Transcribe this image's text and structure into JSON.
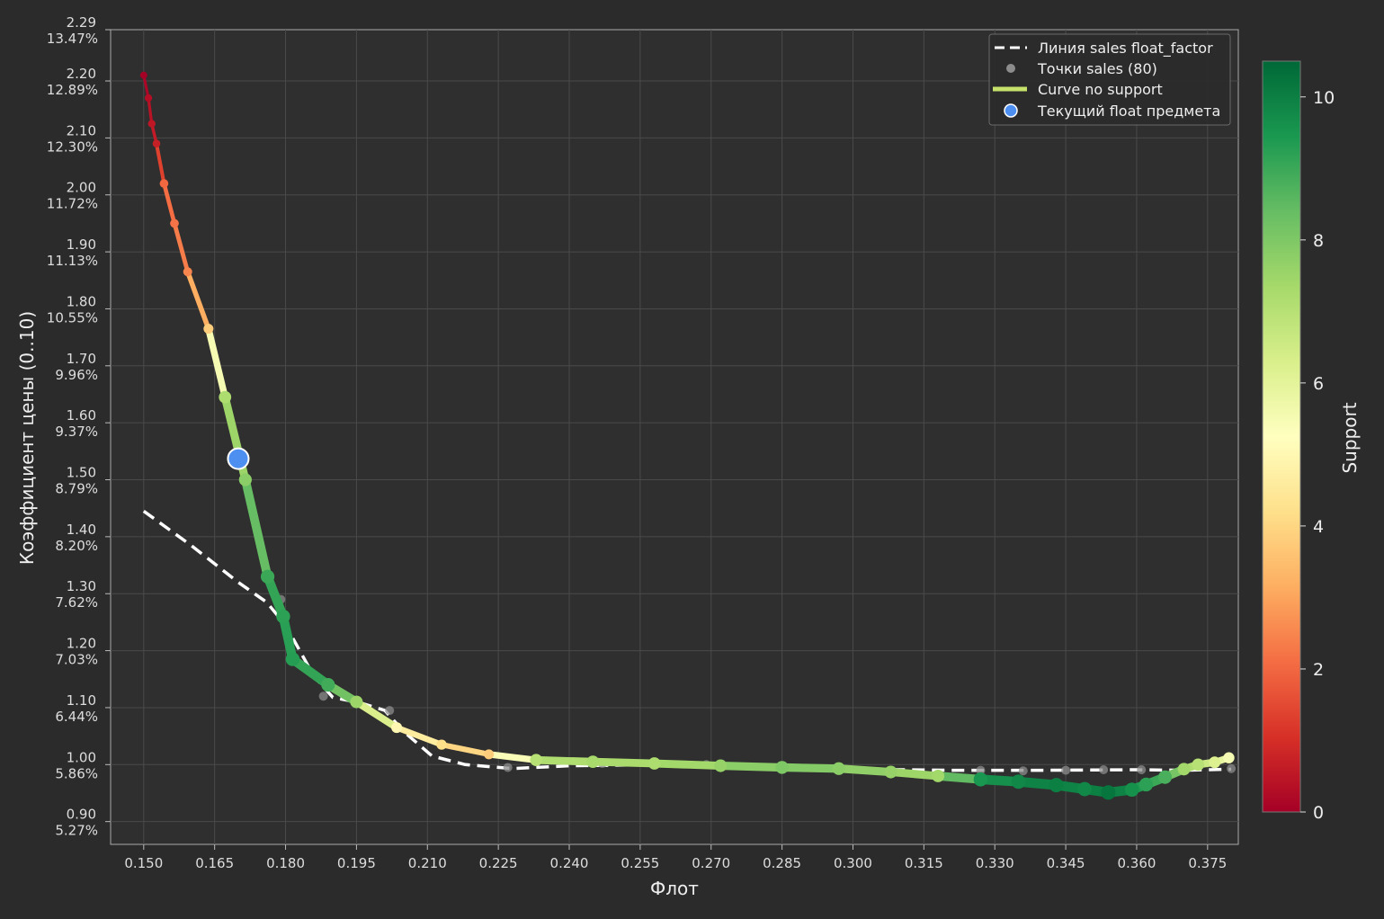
{
  "chart_data": {
    "type": "line",
    "xlabel": "Флот",
    "ylabel": "Коэффициент цены (0..10)",
    "xlim": [
      0.143,
      0.3815
    ],
    "ylim": [
      0.86,
      2.29
    ],
    "x_ticks": [
      "0.150",
      "0.165",
      "0.180",
      "0.195",
      "0.210",
      "0.225",
      "0.240",
      "0.255",
      "0.270",
      "0.285",
      "0.300",
      "0.315",
      "0.330",
      "0.345",
      "0.360",
      "0.375"
    ],
    "y_ticks": [
      {
        "value": 2.29,
        "label": "2.29",
        "pct": "13.47%"
      },
      {
        "value": 2.2,
        "label": "2.20",
        "pct": "12.89%"
      },
      {
        "value": 2.1,
        "label": "2.10",
        "pct": "12.30%"
      },
      {
        "value": 2.0,
        "label": "2.00",
        "pct": "11.72%"
      },
      {
        "value": 1.9,
        "label": "1.90",
        "pct": "11.13%"
      },
      {
        "value": 1.8,
        "label": "1.80",
        "pct": "10.55%"
      },
      {
        "value": 1.7,
        "label": "1.70",
        "pct": "9.96%"
      },
      {
        "value": 1.6,
        "label": "1.60",
        "pct": "9.37%"
      },
      {
        "value": 1.5,
        "label": "1.50",
        "pct": "8.79%"
      },
      {
        "value": 1.4,
        "label": "1.40",
        "pct": "8.20%"
      },
      {
        "value": 1.3,
        "label": "1.30",
        "pct": "7.62%"
      },
      {
        "value": 1.2,
        "label": "1.20",
        "pct": "7.03%"
      },
      {
        "value": 1.1,
        "label": "1.10",
        "pct": "6.44%"
      },
      {
        "value": 1.0,
        "label": "1.00",
        "pct": "5.86%"
      },
      {
        "value": 0.9,
        "label": "0.90",
        "pct": "5.27%"
      }
    ],
    "grid": true,
    "legend_position": "top-right",
    "legend": [
      {
        "label": "Линия sales float_factor",
        "kind": "dashed-line",
        "color": "#ffffff"
      },
      {
        "label": "Точки sales (80)",
        "kind": "dot",
        "color": "#8c8c8c"
      },
      {
        "label": "Curve no support",
        "kind": "line",
        "color": "#c6e26b"
      },
      {
        "label": "Текущий float предмета",
        "kind": "marker",
        "color": "#4d8ff0"
      }
    ],
    "colorbar": {
      "label": "Support",
      "min": 0,
      "max": 10.5,
      "ticks": [
        "0",
        "2",
        "4",
        "6",
        "8",
        "10"
      ],
      "colormap": "RdYlGn"
    },
    "curve": [
      {
        "x": 0.15,
        "y": 2.21,
        "s": 0.0
      },
      {
        "x": 0.151,
        "y": 2.17,
        "s": 0.3
      },
      {
        "x": 0.1517,
        "y": 2.125,
        "s": 0.5
      },
      {
        "x": 0.1527,
        "y": 2.09,
        "s": 0.7
      },
      {
        "x": 0.1543,
        "y": 2.02,
        "s": 2.0
      },
      {
        "x": 0.1565,
        "y": 1.95,
        "s": 2.2
      },
      {
        "x": 0.1593,
        "y": 1.865,
        "s": 2.5
      },
      {
        "x": 0.1637,
        "y": 1.765,
        "s": 3.8
      },
      {
        "x": 0.1672,
        "y": 1.645,
        "s": 7.2
      },
      {
        "x": 0.1715,
        "y": 1.5,
        "s": 7.8
      },
      {
        "x": 0.1762,
        "y": 1.33,
        "s": 9.0
      },
      {
        "x": 0.1795,
        "y": 1.26,
        "s": 9.2
      },
      {
        "x": 0.1815,
        "y": 1.185,
        "s": 9.3
      },
      {
        "x": 0.189,
        "y": 1.14,
        "s": 8.9
      },
      {
        "x": 0.195,
        "y": 1.11,
        "s": 7.5
      },
      {
        "x": 0.2035,
        "y": 1.065,
        "s": 5.0
      },
      {
        "x": 0.213,
        "y": 1.035,
        "s": 4.2
      },
      {
        "x": 0.223,
        "y": 1.018,
        "s": 3.8
      },
      {
        "x": 0.233,
        "y": 1.008,
        "s": 7.0
      },
      {
        "x": 0.245,
        "y": 1.005,
        "s": 7.3
      },
      {
        "x": 0.258,
        "y": 1.002,
        "s": 7.2
      },
      {
        "x": 0.272,
        "y": 0.998,
        "s": 7.6
      },
      {
        "x": 0.285,
        "y": 0.995,
        "s": 8.0
      },
      {
        "x": 0.297,
        "y": 0.993,
        "s": 7.8
      },
      {
        "x": 0.308,
        "y": 0.987,
        "s": 7.6
      },
      {
        "x": 0.318,
        "y": 0.98,
        "s": 7.4
      },
      {
        "x": 0.327,
        "y": 0.974,
        "s": 9.5
      },
      {
        "x": 0.335,
        "y": 0.97,
        "s": 9.8
      },
      {
        "x": 0.343,
        "y": 0.964,
        "s": 10.0
      },
      {
        "x": 0.349,
        "y": 0.957,
        "s": 9.8
      },
      {
        "x": 0.354,
        "y": 0.951,
        "s": 10.2
      },
      {
        "x": 0.359,
        "y": 0.956,
        "s": 9.6
      },
      {
        "x": 0.362,
        "y": 0.965,
        "s": 9.2
      },
      {
        "x": 0.366,
        "y": 0.978,
        "s": 8.8
      },
      {
        "x": 0.37,
        "y": 0.992,
        "s": 7.4
      },
      {
        "x": 0.373,
        "y": 1.0,
        "s": 7.0
      },
      {
        "x": 0.3765,
        "y": 1.004,
        "s": 6.2
      },
      {
        "x": 0.3795,
        "y": 1.012,
        "s": 5.5
      }
    ],
    "sales_line": [
      {
        "x": 0.15,
        "y": 1.445
      },
      {
        "x": 0.16,
        "y": 1.385
      },
      {
        "x": 0.17,
        "y": 1.32
      },
      {
        "x": 0.176,
        "y": 1.285
      },
      {
        "x": 0.18,
        "y": 1.245
      },
      {
        "x": 0.186,
        "y": 1.155
      },
      {
        "x": 0.19,
        "y": 1.118
      },
      {
        "x": 0.196,
        "y": 1.108
      },
      {
        "x": 0.201,
        "y": 1.095
      },
      {
        "x": 0.205,
        "y": 1.058
      },
      {
        "x": 0.211,
        "y": 1.015
      },
      {
        "x": 0.218,
        "y": 1.0
      },
      {
        "x": 0.228,
        "y": 0.993
      },
      {
        "x": 0.24,
        "y": 0.998
      },
      {
        "x": 0.26,
        "y": 1.0
      },
      {
        "x": 0.28,
        "y": 0.998
      },
      {
        "x": 0.3,
        "y": 0.992
      },
      {
        "x": 0.32,
        "y": 0.99
      },
      {
        "x": 0.34,
        "y": 0.99
      },
      {
        "x": 0.36,
        "y": 0.991
      },
      {
        "x": 0.37,
        "y": 0.99
      },
      {
        "x": 0.38,
        "y": 0.992
      }
    ],
    "sales_points": [
      {
        "x": 0.179,
        "y": 1.29
      },
      {
        "x": 0.188,
        "y": 1.12
      },
      {
        "x": 0.202,
        "y": 1.095
      },
      {
        "x": 0.227,
        "y": 0.995
      },
      {
        "x": 0.247,
        "y": 1.002
      },
      {
        "x": 0.269,
        "y": 1.0
      },
      {
        "x": 0.285,
        "y": 0.998
      },
      {
        "x": 0.297,
        "y": 0.994
      },
      {
        "x": 0.327,
        "y": 0.99
      },
      {
        "x": 0.336,
        "y": 0.989
      },
      {
        "x": 0.345,
        "y": 0.99
      },
      {
        "x": 0.353,
        "y": 0.991
      },
      {
        "x": 0.361,
        "y": 0.991
      },
      {
        "x": 0.38,
        "y": 0.993
      }
    ],
    "current_item": {
      "x": 0.17,
      "y": 1.537
    }
  }
}
